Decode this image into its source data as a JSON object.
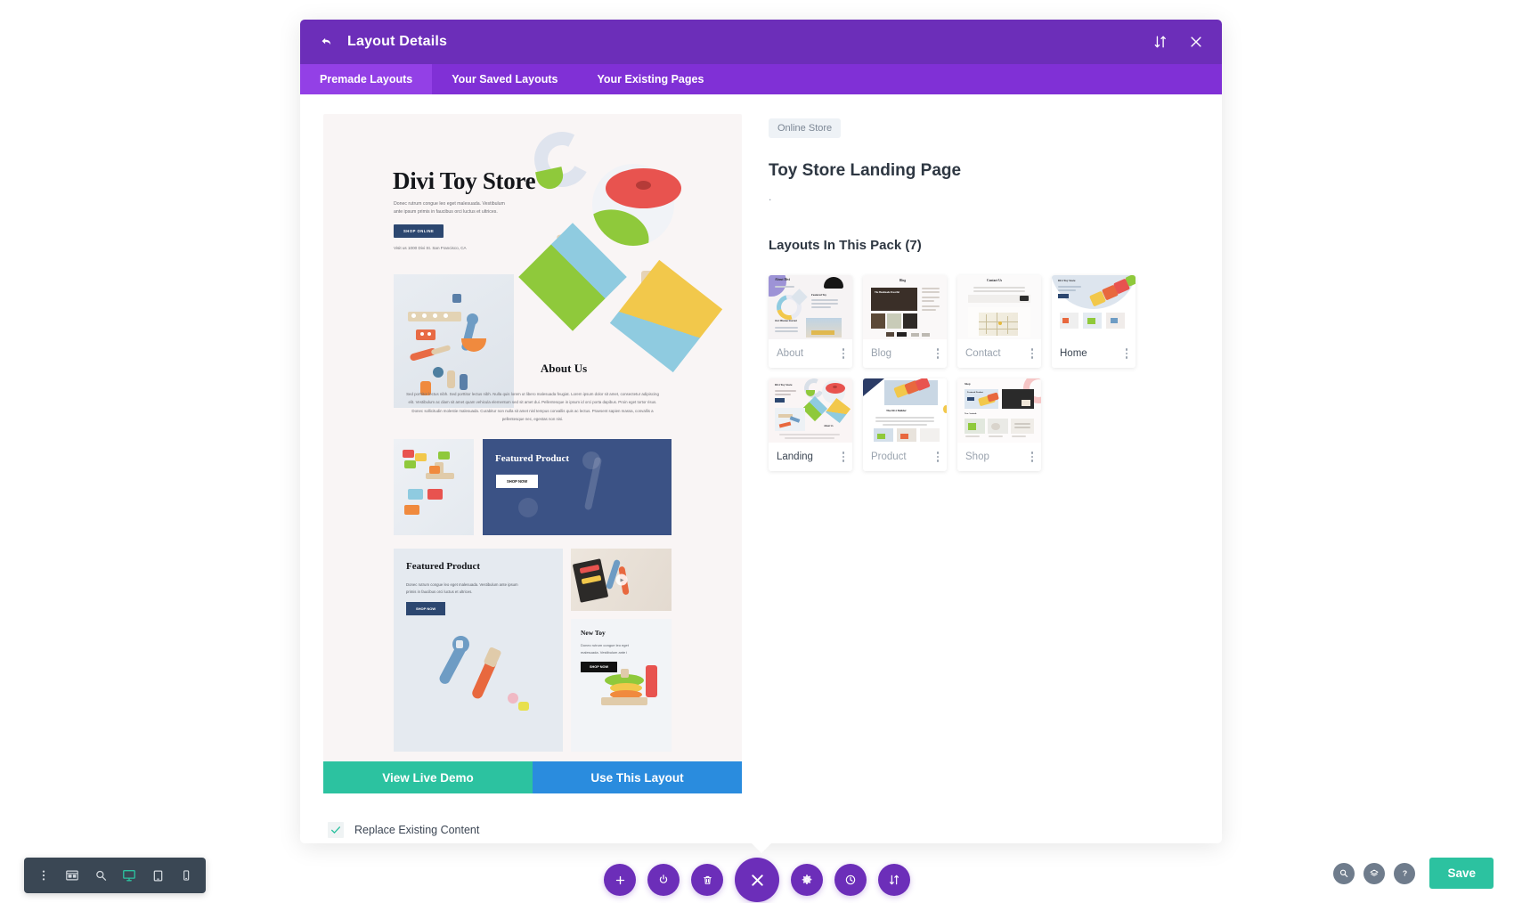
{
  "modal": {
    "title": "Layout Details",
    "back_icon": "back-arrow-icon",
    "sort_icon": "sort-updown-icon",
    "close_icon": "close-x-icon",
    "tabs": [
      {
        "label": "Premade Layouts",
        "active": true
      },
      {
        "label": "Your Saved Layouts",
        "active": false
      },
      {
        "label": "Your Existing Pages",
        "active": false
      }
    ]
  },
  "preview": {
    "hero_title": "Divi Toy Store",
    "hero_paragraph": "Donec rutrum congue leo eget malesuada. Vestibulum ante ipsum primis in faucibus orci luctus et ultrices.",
    "hero_button": "SHOP ONLINE",
    "hero_address": "Visit us 1000 Divi St. San Francisco, CA",
    "about_heading": "About Us",
    "about_paragraph": "Sed porttitor lectus nibh. Sed porttitor lectus nibh. Nulla quis lorem ut libero malesuada feugiat. Lorem ipsum dolor sit amet, consectetur adipiscing elit. Vestibulum ac diam sit amet quam vehicula elementum sed sit amet dui. Pellentesque in ipsum id orci porta dapibus. Proin eget tortor risus. Donec sollicitudin molestie malesuada. Curabitur non nulla sit amet nisl tempus convallis quis ac lectus. Praesent sapien massa, convallis a pellentesque nec, egestas non nisi.",
    "featured_banner_heading": "Featured Product",
    "featured_banner_button": "SHOP NOW",
    "featured_block_heading": "Featured Product",
    "featured_block_paragraph": "Donec rutrum congue leo eget malesuada. Vestibulum ante ipsum primis in faucibus orci luctus et ultrices.",
    "featured_block_button": "SHOP NOW",
    "newtoy_heading": "New Toy",
    "newtoy_paragraph": "Donec rutrum congue leo eget malesuada. Vestibulum ante i",
    "newtoy_button": "SHOP NOW"
  },
  "actions": {
    "view_demo": "View Live Demo",
    "use_layout": "Use This Layout",
    "replace_label": "Replace Existing Content",
    "replace_checked": true,
    "check_icon": "checkmark-icon"
  },
  "details": {
    "category_badge": "Online Store",
    "pack_title": "Toy Store Landing Page",
    "pack_description": ".",
    "pack_count_label": "Layouts In This Pack (7)",
    "cards": [
      {
        "label": "About",
        "thumb": "about-thumb",
        "highlighted": false
      },
      {
        "label": "Blog",
        "thumb": "blog-thumb",
        "highlighted": false
      },
      {
        "label": "Contact",
        "thumb": "contact-thumb",
        "highlighted": false
      },
      {
        "label": "Home",
        "thumb": "home-thumb",
        "highlighted": true
      },
      {
        "label": "Landing",
        "thumb": "landing-thumb",
        "highlighted": true
      },
      {
        "label": "Product",
        "thumb": "product-thumb",
        "highlighted": false
      },
      {
        "label": "Shop",
        "thumb": "shop-thumb",
        "highlighted": false
      }
    ]
  },
  "bottom_left_toolbar": {
    "items": [
      {
        "icon": "kebab-menu-icon",
        "active": false
      },
      {
        "icon": "wireframe-icon",
        "active": false
      },
      {
        "icon": "zoom-search-icon",
        "active": false
      },
      {
        "icon": "desktop-icon",
        "active": true
      },
      {
        "icon": "tablet-icon",
        "active": false
      },
      {
        "icon": "phone-icon",
        "active": false
      }
    ]
  },
  "bottom_center_toolbar": {
    "items": [
      {
        "icon": "plus-icon",
        "size": "small"
      },
      {
        "icon": "power-icon",
        "size": "small"
      },
      {
        "icon": "trash-icon",
        "size": "small"
      },
      {
        "icon": "close-x-icon",
        "size": "large"
      },
      {
        "icon": "gear-icon",
        "size": "small"
      },
      {
        "icon": "history-clock-icon",
        "size": "small"
      },
      {
        "icon": "sort-updown-icon",
        "size": "small"
      }
    ]
  },
  "bottom_right_toolbar": {
    "items": [
      {
        "icon": "zoom-search-icon"
      },
      {
        "icon": "layers-icon"
      },
      {
        "icon": "help-question-icon"
      }
    ],
    "save_label": "Save"
  },
  "colors": {
    "purple_header": "#6C2EB9",
    "purple_tabs": "#8030D6",
    "purple_tab_active": "#9340E6",
    "teal": "#2CC2A0",
    "blue": "#2A8CDE",
    "dark_toolbar": "#3A4754"
  }
}
